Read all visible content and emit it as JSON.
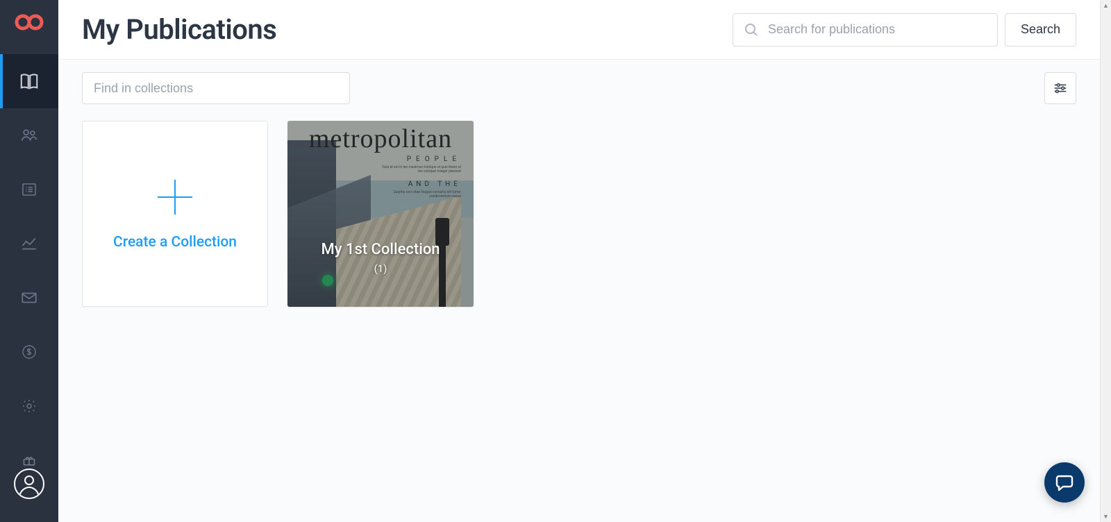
{
  "header": {
    "title": "My Publications",
    "search_placeholder": "Search for publications",
    "search_button": "Search"
  },
  "collections_bar": {
    "find_placeholder": "Find in collections"
  },
  "create_card": {
    "label": "Create a Collection"
  },
  "collections": [
    {
      "name": "My 1st Collection",
      "count_display": "(1)",
      "cover": {
        "masthead": "metropolitan",
        "line1": "PEOPLE",
        "line2": "AND THE"
      }
    }
  ],
  "sidebar": {
    "items": [
      {
        "id": "publications",
        "active": true
      },
      {
        "id": "people"
      },
      {
        "id": "forms"
      },
      {
        "id": "analytics"
      },
      {
        "id": "mail"
      },
      {
        "id": "billing"
      },
      {
        "id": "settings"
      }
    ]
  },
  "colors": {
    "accent": "#1e9df7",
    "brand": "#ef5a55",
    "sidebar_bg": "#2a3240"
  }
}
